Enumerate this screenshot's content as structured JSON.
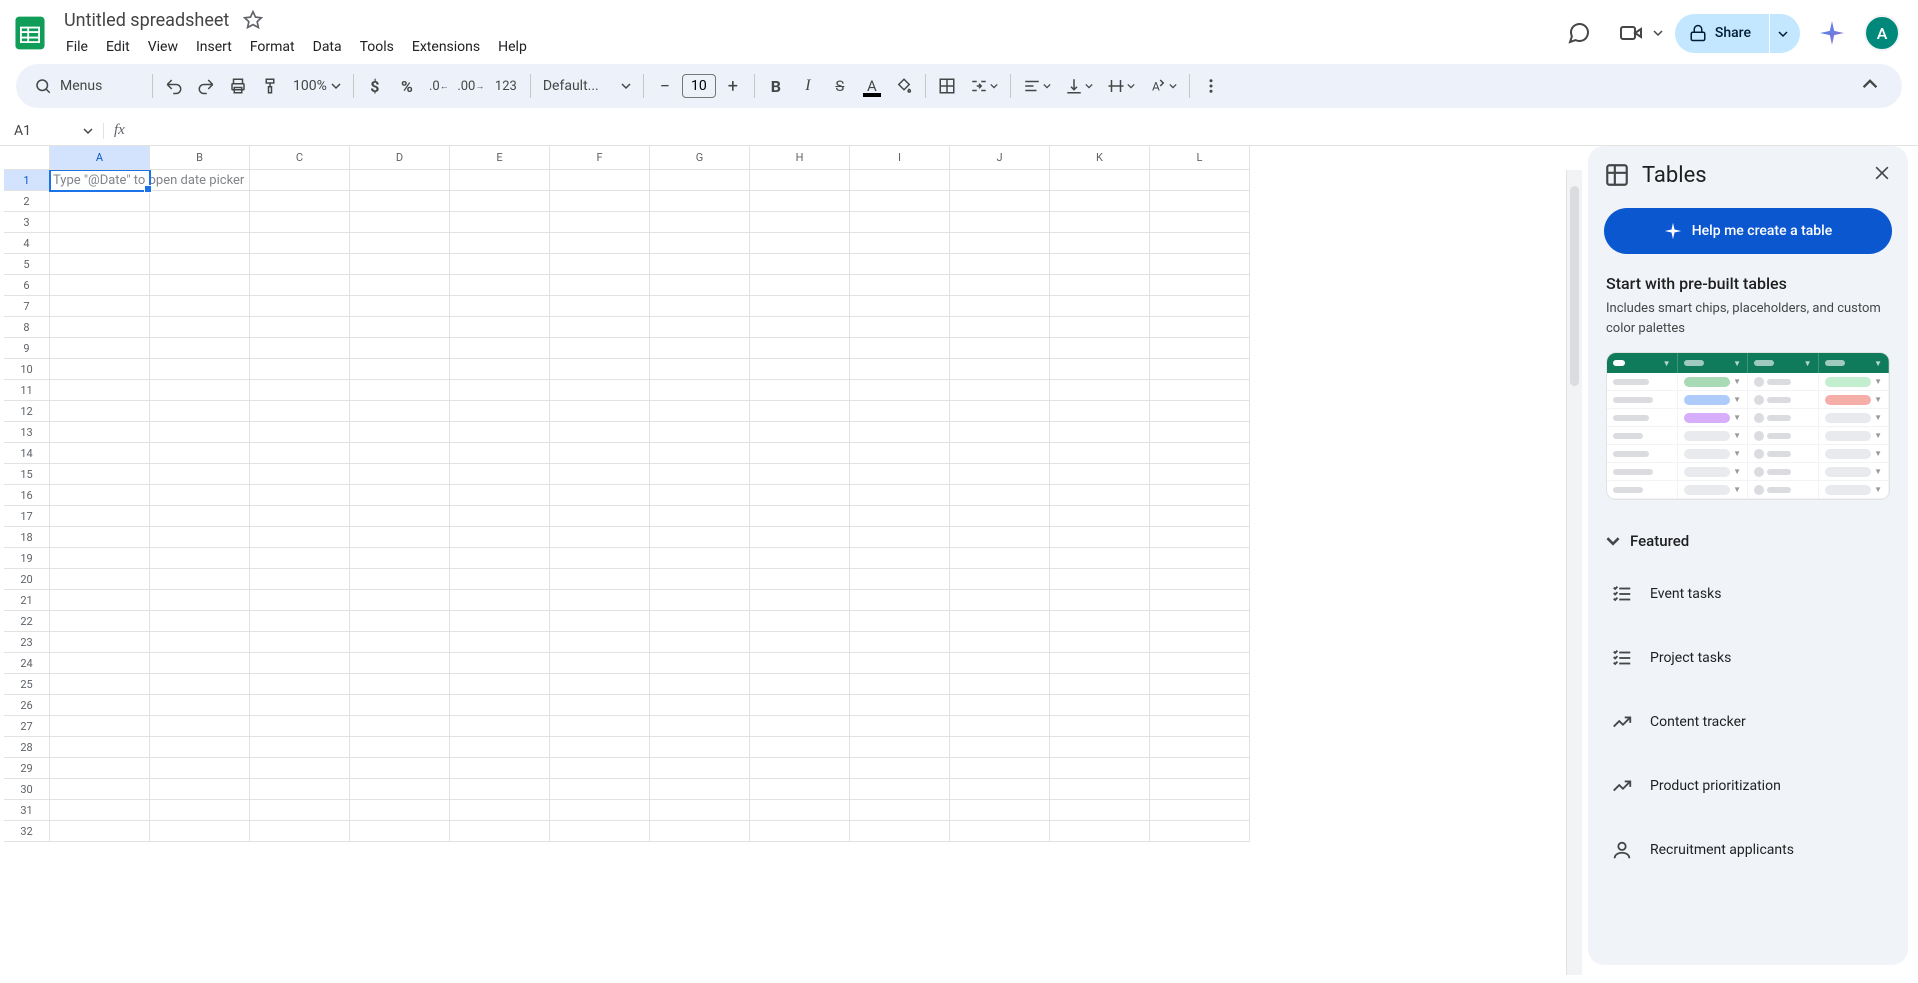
{
  "doc_title": "Untitled spreadsheet",
  "menus": [
    "File",
    "Edit",
    "View",
    "Insert",
    "Format",
    "Data",
    "Tools",
    "Extensions",
    "Help"
  ],
  "search_placeholder": "Menus",
  "toolbar": {
    "zoom": "100%",
    "number_format": "123",
    "font": "Default...",
    "font_size": "10"
  },
  "share_label": "Share",
  "avatar_initial": "A",
  "name_box": "A1",
  "columns": [
    "A",
    "B",
    "C",
    "D",
    "E",
    "F",
    "G",
    "H",
    "I",
    "J",
    "K",
    "L"
  ],
  "rows": 32,
  "cell_placeholder": "Type \"@Date\" to open date picker",
  "sidebar": {
    "title": "Tables",
    "create_btn": "Help me create a table",
    "section_title": "Start with pre-built tables",
    "section_subtitle": "Includes smart chips, placeholders, and custom color palettes",
    "featured": "Featured",
    "templates": [
      {
        "label": "Event tasks",
        "icon": "tasks"
      },
      {
        "label": "Project tasks",
        "icon": "tasks"
      },
      {
        "label": "Content tracker",
        "icon": "activity"
      },
      {
        "label": "Product prioritization",
        "icon": "activity"
      },
      {
        "label": "Recruitment applicants",
        "icon": "person"
      }
    ]
  }
}
